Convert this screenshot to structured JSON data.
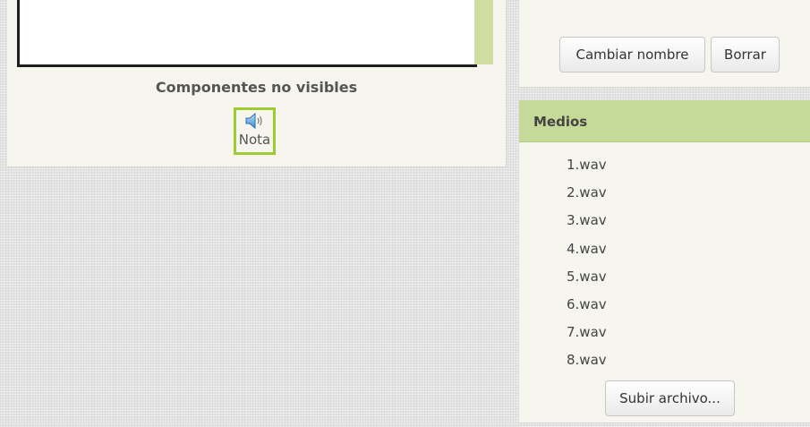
{
  "viewer": {
    "nonvisible_title": "Componentes no visibles",
    "nonvisible_components": [
      {
        "icon": "speaker-icon",
        "label": "Nota"
      }
    ]
  },
  "rename_panel": {
    "rename_label": "Cambiar nombre",
    "delete_label": "Borrar"
  },
  "media": {
    "title": "Medios",
    "files": [
      "1.wav",
      "2.wav",
      "3.wav",
      "4.wav",
      "5.wav",
      "6.wav",
      "7.wav",
      "8.wav"
    ],
    "upload_label": "Subir archivo..."
  },
  "colors": {
    "accent_green": "#9fcb32",
    "header_green": "#c5d998",
    "panel_bg": "#f6f6ef"
  }
}
